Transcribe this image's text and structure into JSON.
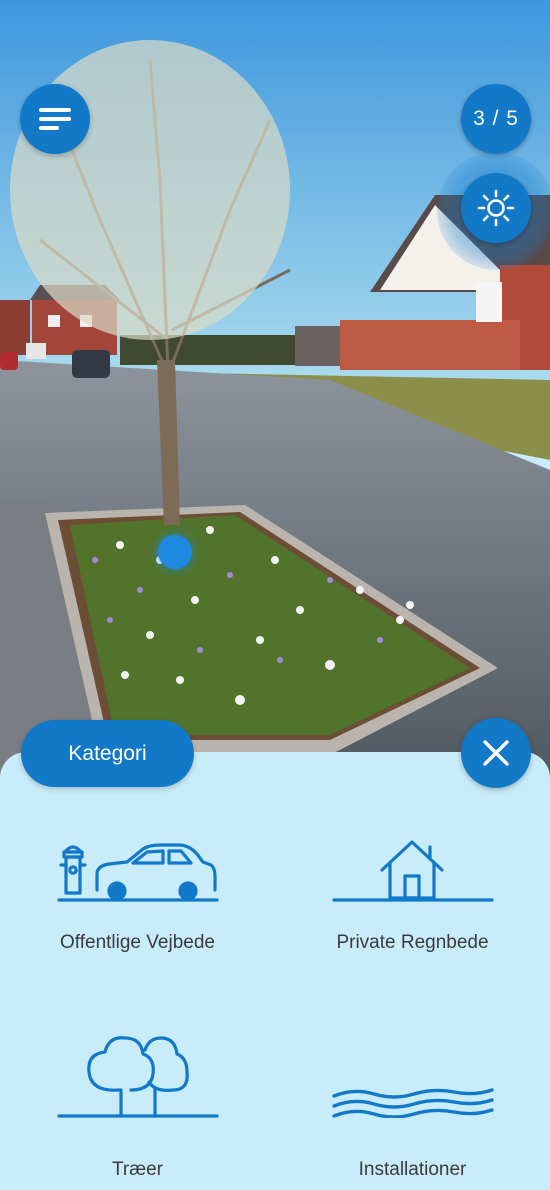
{
  "header": {
    "menu_icon": "hamburger-menu-icon",
    "counter": "3 / 5",
    "light_icon": "sun-icon"
  },
  "sheet": {
    "tab_label": "Kategori",
    "close_icon": "close-x-icon",
    "categories": [
      {
        "label": "Offentlige Vejbede",
        "icon": "car-hydrant-icon"
      },
      {
        "label": "Private Regnbede",
        "icon": "house-icon"
      },
      {
        "label": "Træer",
        "icon": "trees-icon"
      },
      {
        "label": "Installationer",
        "icon": "water-waves-icon"
      }
    ]
  },
  "colors": {
    "accent": "#1279c9",
    "sheet_background": "#c9ecfb",
    "label_text": "#3b3b3b"
  }
}
